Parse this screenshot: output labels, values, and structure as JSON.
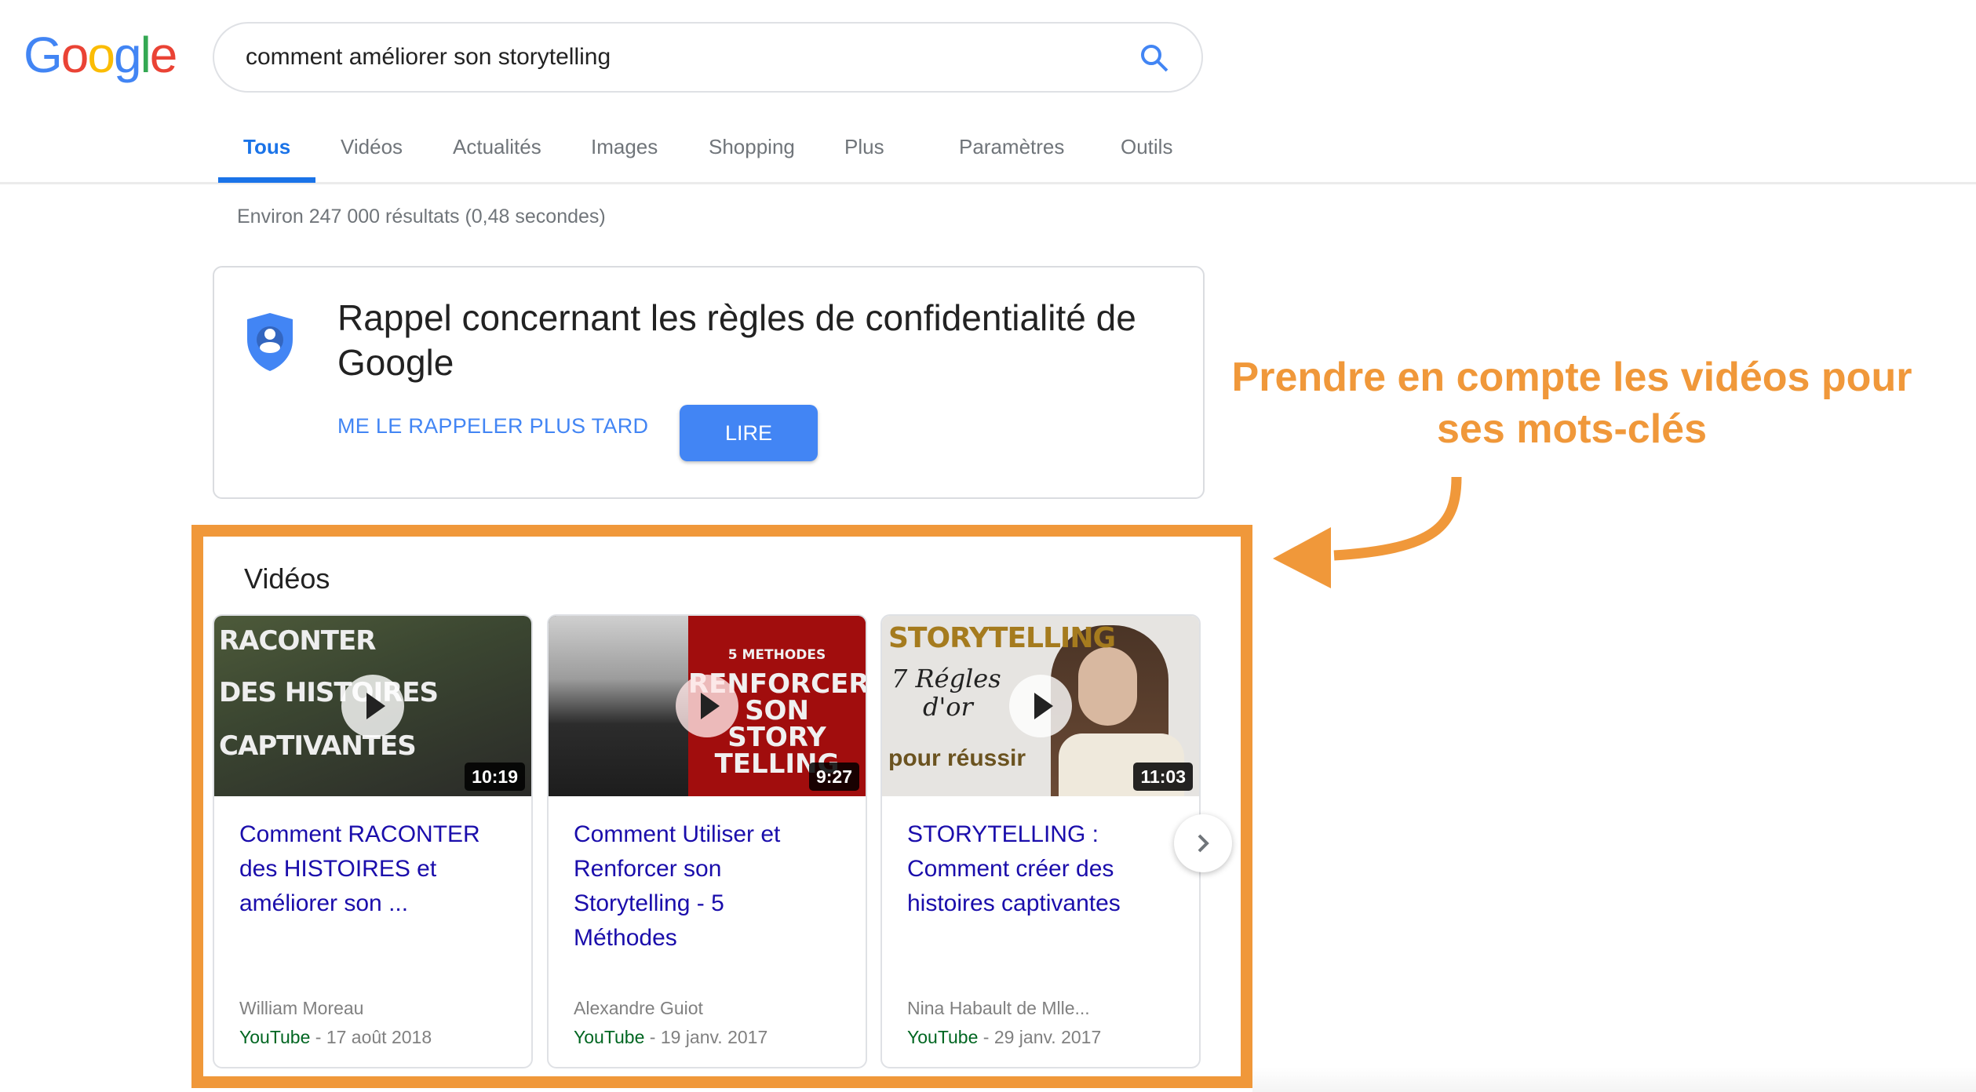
{
  "logo": {
    "letters": [
      "G",
      "o",
      "o",
      "g",
      "l",
      "e"
    ],
    "colors": [
      "#4285F4",
      "#EA4335",
      "#FBBC05",
      "#4285F4",
      "#34A853",
      "#EA4335"
    ]
  },
  "search": {
    "query": "comment améliorer son storytelling",
    "icon": "search-icon"
  },
  "tabs": [
    {
      "label": "Tous",
      "active": true
    },
    {
      "label": "Vidéos"
    },
    {
      "label": "Actualités"
    },
    {
      "label": "Images"
    },
    {
      "label": "Shopping"
    },
    {
      "label": "Plus"
    },
    {
      "label": "Paramètres"
    },
    {
      "label": "Outils"
    }
  ],
  "results_stats": "Environ 247 000 résultats (0,48 secondes)",
  "privacy_card": {
    "icon": "privacy-shield-icon",
    "title": "Rappel concernant les règles de confidentialité de Google",
    "later_label": "ME LE RAPPELER PLUS TARD",
    "read_label": "LIRE"
  },
  "videos": {
    "heading": "Vidéos",
    "items": [
      {
        "thumb_lines": [
          "RACONTER",
          "DES HISTOIRES",
          "CAPTIVANTES"
        ],
        "duration": "10:19",
        "title": "Comment RACONTER des HISTOIRES et améliorer son ...",
        "author": "William Moreau",
        "source": "YouTube",
        "date": " - 17 août 2018"
      },
      {
        "thumb_lines": [
          "5 METHODES",
          "RENFORCER",
          "SON",
          "STORY",
          "TELLING"
        ],
        "duration": "9:27",
        "title": "Comment Utiliser et Renforcer son Storytelling - 5 Méthodes",
        "author": "Alexandre Guiot",
        "source": "YouTube",
        "date": " - 19 janv. 2017"
      },
      {
        "thumb_lines": [
          "STORYTELLING",
          "7 Régles",
          "d'or",
          "pour réussir"
        ],
        "duration": "11:03",
        "title": "STORYTELLING : Comment créer des histoires captivantes",
        "author": "Nina Habault de Mlle...",
        "source": "YouTube",
        "date": " - 29 janv. 2017"
      }
    ],
    "next_icon": "chevron-right-icon"
  },
  "annotation": {
    "text": "Prendre en compte les vidéos pour ses mots-clés",
    "color": "#F0983A"
  },
  "colors": {
    "accent_blue": "#1A73E8",
    "button_blue": "#4285F4",
    "link": "#1A0DAB",
    "source_green": "#006621",
    "highlight_orange": "#F0983A"
  }
}
